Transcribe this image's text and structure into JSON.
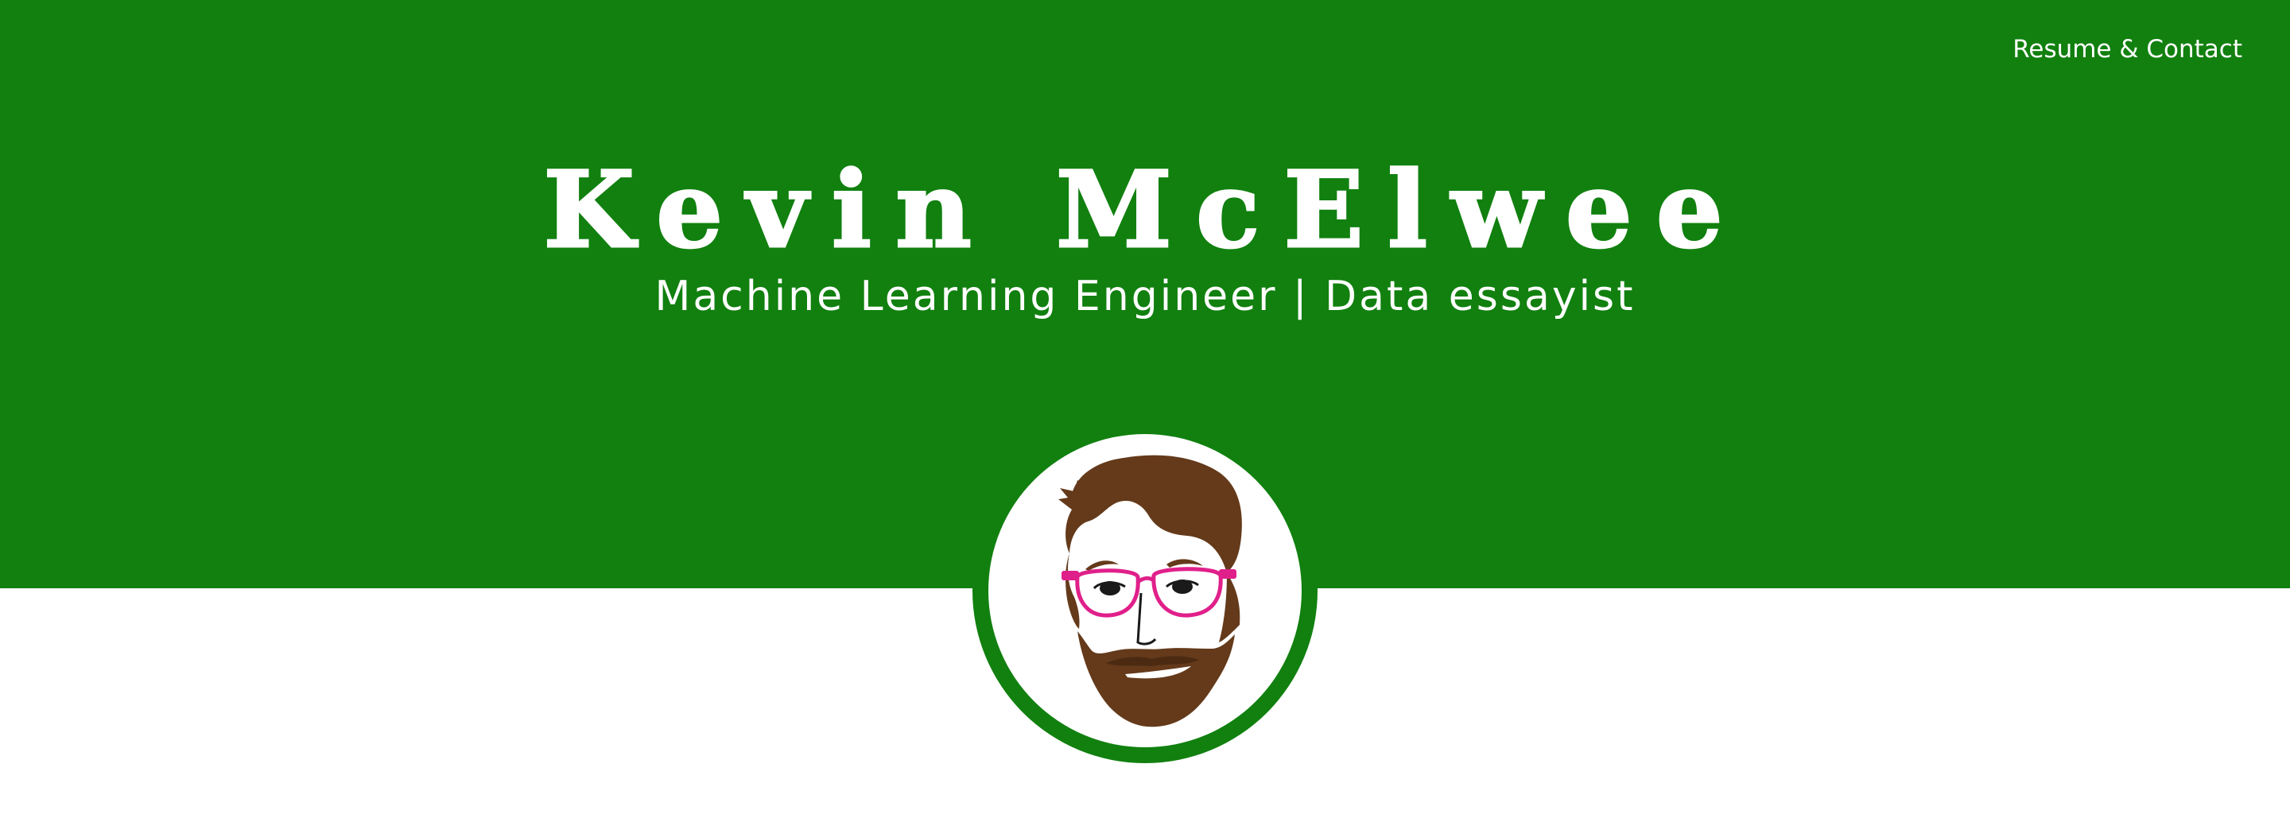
{
  "nav": {
    "resume_contact_label": "Resume & Contact"
  },
  "hero": {
    "name": "Kevin McElwee",
    "tagline": "Machine Learning Engineer | Data essayist"
  },
  "avatar": {
    "icon": "cartoon-portrait-avatar"
  },
  "colors": {
    "brand_green": "#11800f",
    "background": "#ffffff",
    "hair_beard_brown": "#643a1b",
    "glasses_pink": "#e0208a"
  }
}
